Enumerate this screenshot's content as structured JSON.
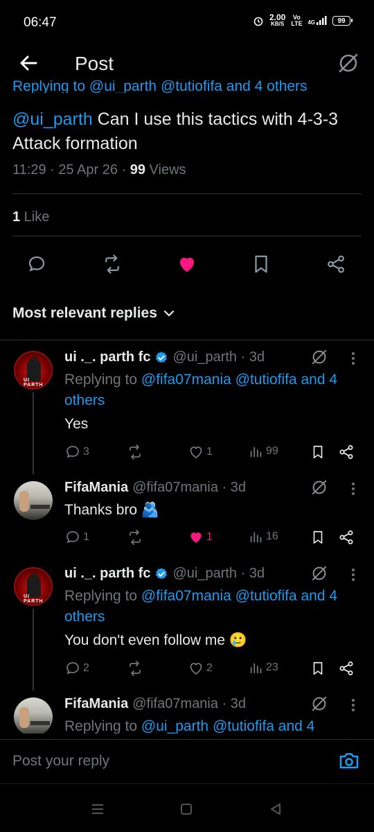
{
  "status": {
    "time": "06:47",
    "net_speed": "2.00",
    "net_unit": "KB/S",
    "carrier": "Vo LTE",
    "signal": "4G",
    "battery": "99"
  },
  "header": {
    "title": "Post",
    "back_icon": "arrow-left-icon",
    "grok_icon": "grok-icon"
  },
  "tweet": {
    "replying_partial": "Replying to @ui_parth @tutiofifa and 4 others",
    "mention": "@ui_parth",
    "text": " Can I use this tactics with 4-3-3 Attack formation",
    "time": "11:29 · 25 Apr 26 · ",
    "views_count": "99",
    "views_label": " Views",
    "likes_count": "1",
    "likes_label": " Like"
  },
  "sort": {
    "label": "Most relevant replies"
  },
  "replies": [
    {
      "name": "ui ._. parth fc",
      "handle": "@ui_parth · 3d",
      "replying_prefix": "Replying to ",
      "replying_targets": "@fifa07mania @tutiofifa and 4 others",
      "text": "Yes",
      "replies": "3",
      "reposts": "",
      "likes": "1",
      "views": "99",
      "liked": false
    },
    {
      "name": "FifaMania",
      "handle": "@fifa07mania · 3d",
      "text": "Thanks bro 🫂",
      "replies": "1",
      "reposts": "",
      "likes": "1",
      "views": "16",
      "liked": true
    },
    {
      "name": "ui ._. parth fc",
      "handle": "@ui_parth · 3d",
      "replying_prefix": "Replying to ",
      "replying_targets": "@fifa07mania @tutiofifa and 4 others",
      "text": "You don't even follow me 🥲",
      "replies": "2",
      "reposts": "",
      "likes": "2",
      "views": "23",
      "liked": false
    },
    {
      "name": "FifaMania",
      "handle": "@fifa07mania · 3d",
      "replying_prefix": "Replying to ",
      "replying_targets": "@ui_parth @tutiofifa and 4"
    }
  ],
  "composer": {
    "placeholder": "Post your reply"
  },
  "colors": {
    "accent": "#1d9bf0",
    "like": "#f91880",
    "muted": "#71767b",
    "background": "#000000"
  }
}
